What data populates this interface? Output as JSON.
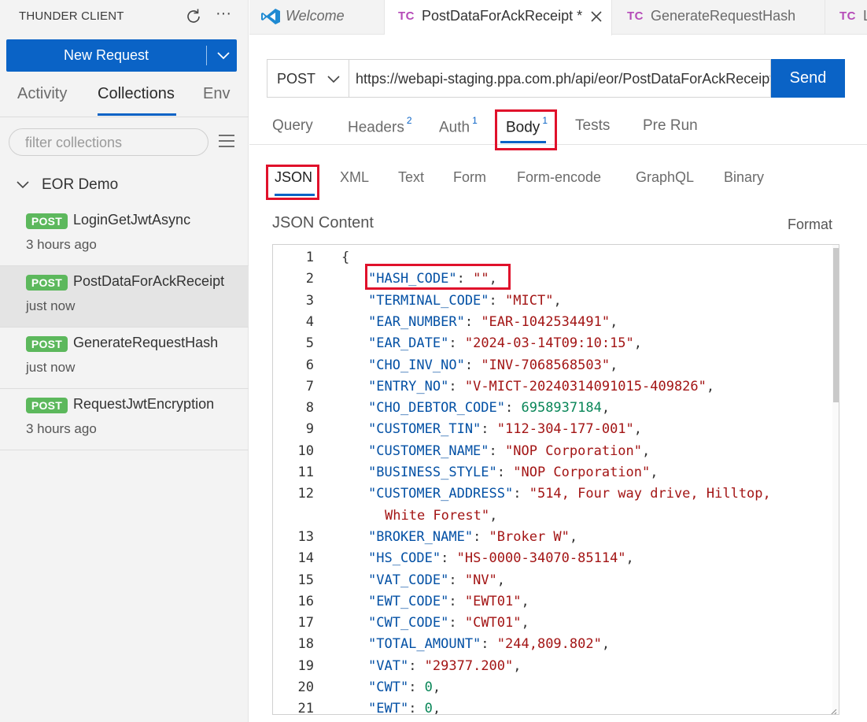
{
  "sidebar": {
    "title": "THUNDER CLIENT",
    "new_request_label": "New Request",
    "tabs": [
      "Activity",
      "Collections",
      "Env"
    ],
    "filter_placeholder": "filter collections",
    "collection_name": "EOR Demo",
    "requests": [
      {
        "method": "POST",
        "name": "LoginGetJwtAsync",
        "time": "3 hours ago"
      },
      {
        "method": "POST",
        "name": "PostDataForAckReceipt",
        "time": "just now"
      },
      {
        "method": "POST",
        "name": "GenerateRequestHash",
        "time": "just now"
      },
      {
        "method": "POST",
        "name": "RequestJwtEncryption",
        "time": "3 hours ago"
      }
    ]
  },
  "editor_tabs": [
    {
      "icon": "vscode-icon",
      "label": "Welcome"
    },
    {
      "icon_text": "TC",
      "label": "PostDataForAckReceipt *"
    },
    {
      "icon_text": "TC",
      "label": "GenerateRequestHash"
    },
    {
      "icon_text": "TC",
      "label": "L"
    }
  ],
  "request": {
    "method": "POST",
    "url": "https://webapi-staging.ppa.com.ph/api/eor/PostDataForAckReceipt",
    "send_label": "Send"
  },
  "request_tabs": [
    {
      "label": "Query",
      "count": ""
    },
    {
      "label": "Headers",
      "count": "2"
    },
    {
      "label": "Auth",
      "count": "1"
    },
    {
      "label": "Body",
      "count": "1"
    },
    {
      "label": "Tests",
      "count": ""
    },
    {
      "label": "Pre Run",
      "count": ""
    }
  ],
  "body_tabs": [
    "JSON",
    "XML",
    "Text",
    "Form",
    "Form-encode",
    "GraphQL",
    "Binary"
  ],
  "json_content_title": "JSON Content",
  "format_label": "Format",
  "code_lines": [
    {
      "n": "1",
      "tokens": [
        [
          "p",
          "{"
        ]
      ]
    },
    {
      "n": "2",
      "tokens": [
        [
          "k",
          "\"HASH_CODE\""
        ],
        [
          "p",
          ": "
        ],
        [
          "s",
          "\"\""
        ],
        [
          "p",
          ","
        ]
      ]
    },
    {
      "n": "3",
      "tokens": [
        [
          "k",
          "\"TERMINAL_CODE\""
        ],
        [
          "p",
          ": "
        ],
        [
          "s",
          "\"MICT\""
        ],
        [
          "p",
          ","
        ]
      ]
    },
    {
      "n": "4",
      "tokens": [
        [
          "k",
          "\"EAR_NUMBER\""
        ],
        [
          "p",
          ": "
        ],
        [
          "s",
          "\"EAR-1042534491\""
        ],
        [
          "p",
          ","
        ]
      ]
    },
    {
      "n": "5",
      "tokens": [
        [
          "k",
          "\"EAR_DATE\""
        ],
        [
          "p",
          ": "
        ],
        [
          "s",
          "\"2024-03-14T09:10:15\""
        ],
        [
          "p",
          ","
        ]
      ]
    },
    {
      "n": "6",
      "tokens": [
        [
          "k",
          "\"CHO_INV_NO\""
        ],
        [
          "p",
          ": "
        ],
        [
          "s",
          "\"INV-7068568503\""
        ],
        [
          "p",
          ","
        ]
      ]
    },
    {
      "n": "7",
      "tokens": [
        [
          "k",
          "\"ENTRY_NO\""
        ],
        [
          "p",
          ": "
        ],
        [
          "s",
          "\"V-MICT-20240314091015-409826\""
        ],
        [
          "p",
          ","
        ]
      ]
    },
    {
      "n": "8",
      "tokens": [
        [
          "k",
          "\"CHO_DEBTOR_CODE\""
        ],
        [
          "p",
          ": "
        ],
        [
          "n",
          "6958937184"
        ],
        [
          "p",
          ","
        ]
      ]
    },
    {
      "n": "9",
      "tokens": [
        [
          "k",
          "\"CUSTOMER_TIN\""
        ],
        [
          "p",
          ": "
        ],
        [
          "s",
          "\"112-304-177-001\""
        ],
        [
          "p",
          ","
        ]
      ]
    },
    {
      "n": "10",
      "tokens": [
        [
          "k",
          "\"CUSTOMER_NAME\""
        ],
        [
          "p",
          ": "
        ],
        [
          "s",
          "\"NOP Corporation\""
        ],
        [
          "p",
          ","
        ]
      ]
    },
    {
      "n": "11",
      "tokens": [
        [
          "k",
          "\"BUSINESS_STYLE\""
        ],
        [
          "p",
          ": "
        ],
        [
          "s",
          "\"NOP Corporation\""
        ],
        [
          "p",
          ","
        ]
      ]
    },
    {
      "n": "12",
      "tokens": [
        [
          "k",
          "\"CUSTOMER_ADDRESS\""
        ],
        [
          "p",
          ": "
        ],
        [
          "s",
          "\"514, Four way drive, Hilltop,"
        ]
      ]
    },
    {
      "n": "",
      "wrap": true,
      "tokens": [
        [
          "s",
          "White Forest\""
        ],
        [
          "p",
          ","
        ]
      ]
    },
    {
      "n": "13",
      "tokens": [
        [
          "k",
          "\"BROKER_NAME\""
        ],
        [
          "p",
          ": "
        ],
        [
          "s",
          "\"Broker W\""
        ],
        [
          "p",
          ","
        ]
      ]
    },
    {
      "n": "14",
      "tokens": [
        [
          "k",
          "\"HS_CODE\""
        ],
        [
          "p",
          ": "
        ],
        [
          "s",
          "\"HS-0000-34070-85114\""
        ],
        [
          "p",
          ","
        ]
      ]
    },
    {
      "n": "15",
      "tokens": [
        [
          "k",
          "\"VAT_CODE\""
        ],
        [
          "p",
          ": "
        ],
        [
          "s",
          "\"NV\""
        ],
        [
          "p",
          ","
        ]
      ]
    },
    {
      "n": "16",
      "tokens": [
        [
          "k",
          "\"EWT_CODE\""
        ],
        [
          "p",
          ": "
        ],
        [
          "s",
          "\"EWT01\""
        ],
        [
          "p",
          ","
        ]
      ]
    },
    {
      "n": "17",
      "tokens": [
        [
          "k",
          "\"CWT_CODE\""
        ],
        [
          "p",
          ": "
        ],
        [
          "s",
          "\"CWT01\""
        ],
        [
          "p",
          ","
        ]
      ]
    },
    {
      "n": "18",
      "tokens": [
        [
          "k",
          "\"TOTAL_AMOUNT\""
        ],
        [
          "p",
          ": "
        ],
        [
          "s",
          "\"244,809.802\""
        ],
        [
          "p",
          ","
        ]
      ]
    },
    {
      "n": "19",
      "tokens": [
        [
          "k",
          "\"VAT\""
        ],
        [
          "p",
          ": "
        ],
        [
          "s",
          "\"29377.200\""
        ],
        [
          "p",
          ","
        ]
      ]
    },
    {
      "n": "20",
      "tokens": [
        [
          "k",
          "\"CWT\""
        ],
        [
          "p",
          ": "
        ],
        [
          "n",
          "0"
        ],
        [
          "p",
          ","
        ]
      ]
    },
    {
      "n": "21",
      "tokens": [
        [
          "k",
          "\"EWT\""
        ],
        [
          "p",
          ": "
        ],
        [
          "n",
          "0"
        ],
        [
          "p",
          ","
        ]
      ]
    }
  ],
  "colors": {
    "accent": "#0a63c6",
    "post_badge": "#5cb85c",
    "highlight_box": "#e0112b",
    "json_key": "#0451a5",
    "json_string": "#a31515",
    "json_number": "#098658",
    "tc_icon": "#b54bb8"
  }
}
